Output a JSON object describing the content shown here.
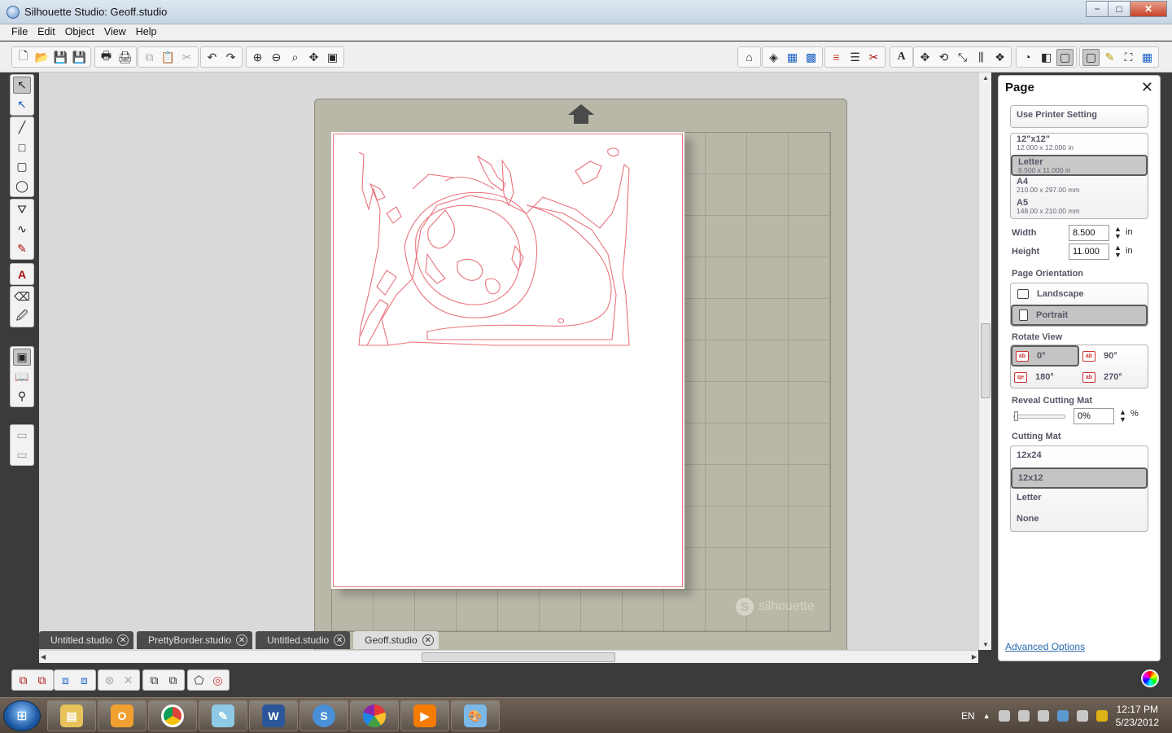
{
  "window": {
    "title": "Silhouette Studio: Geoff.studio",
    "buttons": [
      "−",
      "□",
      "✕"
    ]
  },
  "menu": [
    "File",
    "Edit",
    "Object",
    "View",
    "Help"
  ],
  "toolbar": {
    "left_groups": [
      [
        "new-document-icon",
        "open-folder-icon",
        "save-icon",
        "save-to-library-icon"
      ],
      [
        "print-icon",
        "print-and-cut-icon"
      ],
      [
        "copy-icon",
        "paste-icon",
        "cut-icon"
      ],
      [
        "undo-icon",
        "redo-icon"
      ],
      [
        "zoom-in-icon",
        "zoom-out-icon",
        "zoom-select-icon",
        "pan-icon",
        "fit-to-page-icon"
      ]
    ],
    "right_groups": [
      [
        "home-icon"
      ],
      [
        "fill-color-icon",
        "fill-gradient-icon",
        "fill-pattern-icon"
      ],
      [
        "line-color-icon",
        "line-style-icon",
        "cut-style-icon"
      ],
      [
        "text-style-icon"
      ],
      [
        "transform-icon",
        "rotate-icon",
        "scale-icon",
        "align-icon",
        "replicate-icon"
      ],
      [
        "offset-icon",
        "trace-icon",
        "page-settings-icon"
      ],
      [
        "sketch-icon",
        "select-fullscreen-icon",
        "grid-icon"
      ]
    ]
  },
  "left_tools": [
    [
      "select-tool-icon",
      "point-edit-tool-icon"
    ],
    [
      "line-tool-icon",
      "rectangle-tool-icon",
      "rounded-rectangle-tool-icon",
      "ellipse-tool-icon"
    ],
    [
      "polygon-tool-icon",
      "curve-tool-icon",
      "freehand-tool-icon"
    ],
    [
      "text-tool-icon"
    ],
    [
      "eraser-tool-icon",
      "knife-tool-icon"
    ],
    [
      "cutting-mat-view-icon",
      "library-icon",
      "store-icon"
    ],
    [
      "panel-top-icon",
      "panel-bottom-icon"
    ]
  ],
  "mat": {
    "brand": "silhouette"
  },
  "tabs": [
    {
      "label": "Untitled.studio",
      "active": false
    },
    {
      "label": "PrettyBorder.studio",
      "active": false
    },
    {
      "label": "Untitled.studio",
      "active": false
    },
    {
      "label": "Geoff.studio",
      "active": true
    }
  ],
  "bottom_toolbar": [
    [
      "group-icon",
      "ungroup-icon"
    ],
    [
      "make-compound-icon",
      "release-compound-icon"
    ],
    [
      "weld-icon",
      "subtract-icon"
    ],
    [
      "bring-front-icon",
      "send-back-icon"
    ],
    [
      "register-icon",
      "cut-settings-icon"
    ]
  ],
  "page_panel": {
    "title": "Page",
    "printer_setting": "Use Printer Setting",
    "page_sizes": [
      {
        "name": "12\"x12\"",
        "dims": "12.000 x 12.000 in",
        "selected": false
      },
      {
        "name": "Letter",
        "dims": "8.500 x 11.000 in",
        "selected": true
      },
      {
        "name": "A4",
        "dims": "210.00 x 297.00 mm",
        "selected": false
      },
      {
        "name": "A5",
        "dims": "148.00 x 210.00 mm",
        "selected": false
      }
    ],
    "width_label": "Width",
    "width_value": "8.500",
    "height_label": "Height",
    "height_value": "11.000",
    "unit": "in",
    "orientation_label": "Page Orientation",
    "orientations": [
      {
        "label": "Landscape",
        "selected": false
      },
      {
        "label": "Portrait",
        "selected": true
      }
    ],
    "rotate_label": "Rotate View",
    "rotations": [
      {
        "label": "0°",
        "selected": true
      },
      {
        "label": "90°",
        "selected": false
      },
      {
        "label": "180°",
        "selected": false
      },
      {
        "label": "270°",
        "selected": false
      }
    ],
    "reveal_label": "Reveal Cutting Mat",
    "reveal_value": "0%",
    "reveal_unit": "%",
    "reveal_fraction": 0,
    "mat_label": "Cutting Mat",
    "mats": [
      {
        "label": "12x24",
        "selected": false
      },
      {
        "label": "12x12",
        "selected": true
      },
      {
        "label": "Letter",
        "selected": false
      },
      {
        "label": "None",
        "selected": false
      }
    ],
    "advanced_link": "Advanced Options"
  },
  "taskbar": {
    "apps": [
      "explorer-icon",
      "outlook-icon",
      "chrome-icon",
      "notepad-icon",
      "word-icon",
      "silhouette-studio-icon",
      "picasa-icon",
      "media-player-icon",
      "paint-icon"
    ],
    "language": "EN",
    "time": "12:17 PM",
    "date": "5/23/2012"
  },
  "colors": {
    "cut_line": "#e9737d",
    "mat": "#b9b7a7",
    "selected_fill": "#c4c4c4",
    "link": "#2a6ab0"
  }
}
